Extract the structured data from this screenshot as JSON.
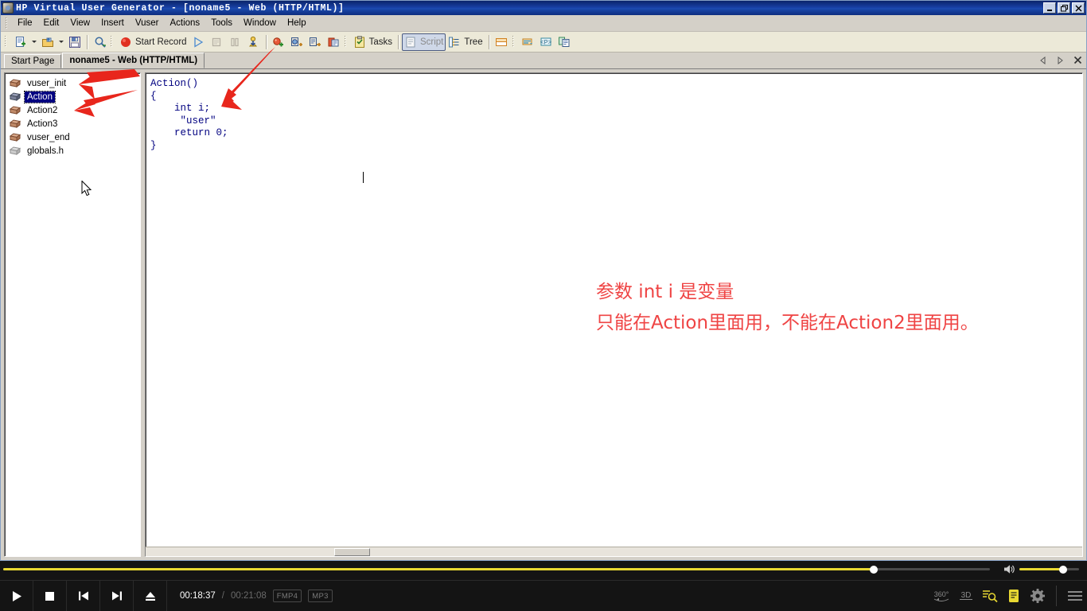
{
  "window": {
    "title": "HP Virtual User Generator - [noname5 - Web (HTTP/HTML)]",
    "icon": "app-icon",
    "buttons": {
      "minimize": "minimize-icon",
      "restore": "restore-icon",
      "close": "close-icon"
    }
  },
  "menubar": {
    "items": [
      {
        "label": "File"
      },
      {
        "label": "Edit"
      },
      {
        "label": "View"
      },
      {
        "label": "Insert"
      },
      {
        "label": "Vuser"
      },
      {
        "label": "Actions"
      },
      {
        "label": "Tools"
      },
      {
        "label": "Window"
      },
      {
        "label": "Help"
      }
    ]
  },
  "toolbar": {
    "new_script": "new-script-icon",
    "open": "open-folder-icon",
    "save": "save-disk-icon",
    "zoom": "magnifier-icon",
    "start_record_label": "Start Record",
    "record_icon": "record-dot-icon",
    "run_icon": "play-icon",
    "stop_icon": "stop-icon",
    "pause_icon": "pause-icon",
    "vuser_icon": "vuser-download-icon",
    "tree_add_icon": "add-transaction-icon",
    "rendezvous_icon": "rendezvous-icon",
    "think_time_icon": "think-time-icon",
    "comment_icon": "comment-icon",
    "tasks_label": "Tasks",
    "tasks_icon": "tasks-clipboard-icon",
    "script_label": "Script",
    "script_icon": "script-page-icon",
    "tree_label": "Tree",
    "tree_icon": "tree-view-icon",
    "split_icon": "split-window-icon",
    "recording_options_icon": "recording-options-icon",
    "parameter_icon": "parameter-p-icon",
    "snapshot_icon": "snapshot-icon"
  },
  "tabs": {
    "items": [
      {
        "label": "Start Page",
        "active": false
      },
      {
        "label": "noname5 - Web (HTTP/HTML)",
        "active": true
      }
    ],
    "nav": {
      "prev": "prev-tab-icon",
      "next": "next-tab-icon",
      "close": "close-tab-icon"
    }
  },
  "tree": {
    "items": [
      {
        "label": "vuser_init",
        "icon": "action-block-icon",
        "selected": false
      },
      {
        "label": "Action",
        "icon": "action-block-icon",
        "selected": true
      },
      {
        "label": "Action2",
        "icon": "action-block-icon",
        "selected": false
      },
      {
        "label": "Action3",
        "icon": "action-block-icon",
        "selected": false
      },
      {
        "label": "vuser_end",
        "icon": "action-block-icon",
        "selected": false
      },
      {
        "label": "globals.h",
        "icon": "header-file-icon",
        "selected": false
      }
    ]
  },
  "code": {
    "lines": [
      "Action()",
      "{",
      "    int i;",
      "     \"user\"",
      "    return 0;",
      "}"
    ]
  },
  "annotation": {
    "line1": "参数 int i 是变量",
    "line2": "只能在Action里面用，不能在Action2里面用。",
    "color": "#ef4444"
  },
  "player": {
    "controls": {
      "play": "play-icon",
      "stop": "stop-icon",
      "prev": "previous-track-icon",
      "next": "next-track-icon",
      "eject": "eject-icon"
    },
    "time_current": "00:18:37",
    "time_separator": "/",
    "time_total": "00:21:08",
    "format_video": "FMP4",
    "format_audio": "MP3",
    "right_tools": [
      {
        "name": "360-view-icon",
        "label": "360°"
      },
      {
        "name": "3d-view-icon",
        "label": "3D"
      },
      {
        "name": "search-zoom-icon",
        "label": ""
      },
      {
        "name": "notes-icon",
        "label": ""
      },
      {
        "name": "settings-gear-icon",
        "label": ""
      },
      {
        "name": "menu-hamburger-icon",
        "label": ""
      }
    ],
    "volume_icon": "volume-speaker-icon",
    "accent_color": "#e8d832"
  }
}
